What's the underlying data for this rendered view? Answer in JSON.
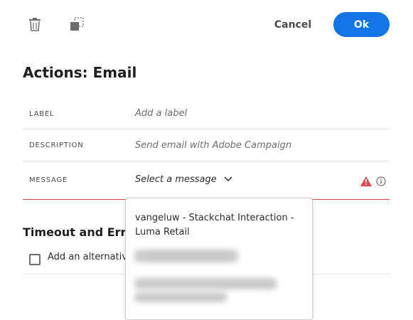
{
  "toolbar": {
    "delete_icon": "trash-icon",
    "duplicate_icon": "duplicate-icon",
    "cancel_label": "Cancel",
    "ok_label": "Ok"
  },
  "page_title": "Actions: Email",
  "fields": {
    "label": {
      "name": "LABEL",
      "placeholder": "Add a label"
    },
    "description": {
      "name": "DESCRIPTION",
      "placeholder": "Send email with Adobe Campaign"
    },
    "message": {
      "name": "MESSAGE",
      "value": "Select a message",
      "status": "error",
      "error_icon": "alert-triangle-icon",
      "info_icon": "info-icon"
    }
  },
  "timeout_section": {
    "title": "Timeout and Erro",
    "checkbox_label": "Add an alternative",
    "checked": false
  },
  "message_dropdown": {
    "options": [
      {
        "label": "vangeluw - Stackchat Interaction - Luma Retail"
      }
    ]
  },
  "colors": {
    "primary": "#1473e6",
    "error": "#e34850",
    "border": "#e3e3e3"
  }
}
